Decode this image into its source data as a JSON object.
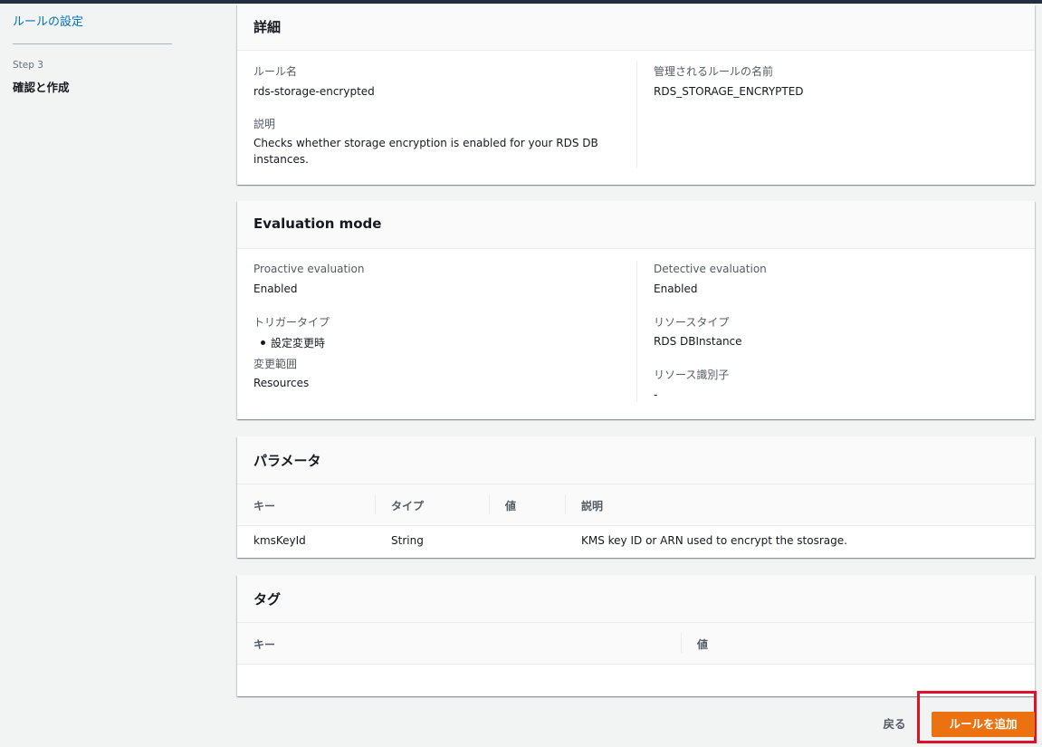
{
  "sidebar": {
    "rule_settings_link": "ルールの設定",
    "step_label": "Step 3",
    "step_title": "確認と作成"
  },
  "details": {
    "title": "詳細",
    "rule_name_label": "ルール名",
    "rule_name_value": "rds-storage-encrypted",
    "description_label": "説明",
    "description_value": "Checks whether storage encryption is enabled for your RDS DB instances.",
    "managed_rule_label": "管理されるルールの名前",
    "managed_rule_value": "RDS_STORAGE_ENCRYPTED"
  },
  "evaluation": {
    "title": "Evaluation mode",
    "proactive_label": "Proactive evaluation",
    "proactive_value": "Enabled",
    "trigger_label": "トリガータイプ",
    "trigger_value": "設定変更時",
    "scope_label": "変更範囲",
    "scope_value": "Resources",
    "detective_label": "Detective evaluation",
    "detective_value": "Enabled",
    "resource_type_label": "リソースタイプ",
    "resource_type_value": "RDS DBInstance",
    "resource_id_label": "リソース識別子",
    "resource_id_value": "-"
  },
  "parameters": {
    "title": "パラメータ",
    "columns": [
      "キー",
      "タイプ",
      "値",
      "説明"
    ],
    "rows": [
      {
        "key": "kmsKeyId",
        "type": "String",
        "value": "",
        "description": "KMS key ID or ARN used to encrypt the stosrage."
      }
    ]
  },
  "tags": {
    "title": "タグ",
    "columns": [
      "キー",
      "値"
    ]
  },
  "footer": {
    "back_label": "戻る",
    "add_rule_label": "ルールを追加"
  },
  "colors": {
    "primary": "#ec7211",
    "link": "#0073bb",
    "highlight": "#e0102a"
  }
}
